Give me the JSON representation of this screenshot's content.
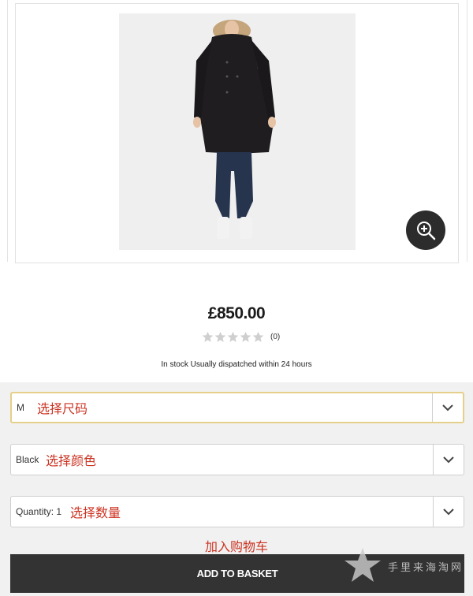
{
  "product": {
    "image_alt": "Black parka product photo",
    "price": "£850.00",
    "rating": {
      "stars": 0,
      "max": 5,
      "review_count": "(0)"
    },
    "stock_status": "In stock Usually dispatched within 24 hours"
  },
  "options": {
    "size": {
      "value": "M",
      "note": "选择尺码"
    },
    "color": {
      "value": "Black",
      "note": "选择颜色"
    },
    "quantity": {
      "value": "Quantity: 1",
      "note": "选择数量"
    }
  },
  "basket": {
    "note": "加入购物车",
    "button_label": "ADD TO BASKET"
  },
  "watermark": {
    "text": "手里来海淘网"
  },
  "colors": {
    "accent_red": "#cc3322",
    "button_bg": "#333333",
    "focus_border": "#e6cf8a",
    "zoom_bg": "#2c2c2c"
  },
  "icons": [
    "zoom-in-icon",
    "star-icon",
    "chevron-down-icon",
    "star-logo-icon"
  ]
}
